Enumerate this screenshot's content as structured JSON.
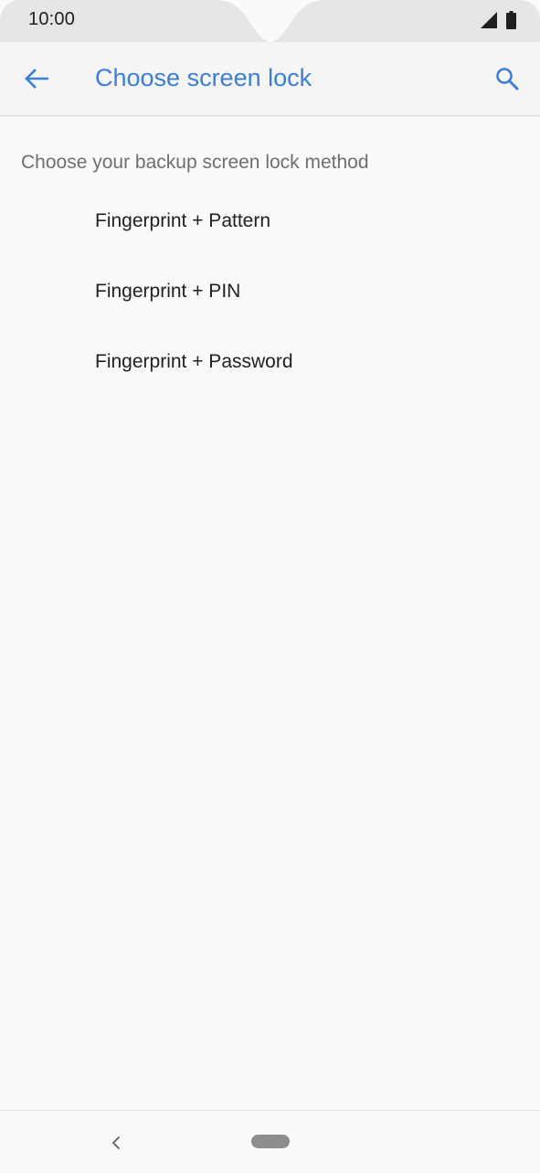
{
  "status_bar": {
    "time": "10:00"
  },
  "app_bar": {
    "title": "Choose screen lock",
    "accent_color": "#3c7fd8",
    "back_icon": "arrow-left-icon",
    "search_icon": "search-icon"
  },
  "content": {
    "section_header": "Choose your backup screen lock method",
    "options": [
      {
        "label": "Fingerprint + Pattern"
      },
      {
        "label": "Fingerprint + PIN"
      },
      {
        "label": "Fingerprint + Password"
      }
    ]
  },
  "nav_bar": {
    "back_icon": "chevron-left-icon",
    "home_icon": "home-pill-icon"
  }
}
